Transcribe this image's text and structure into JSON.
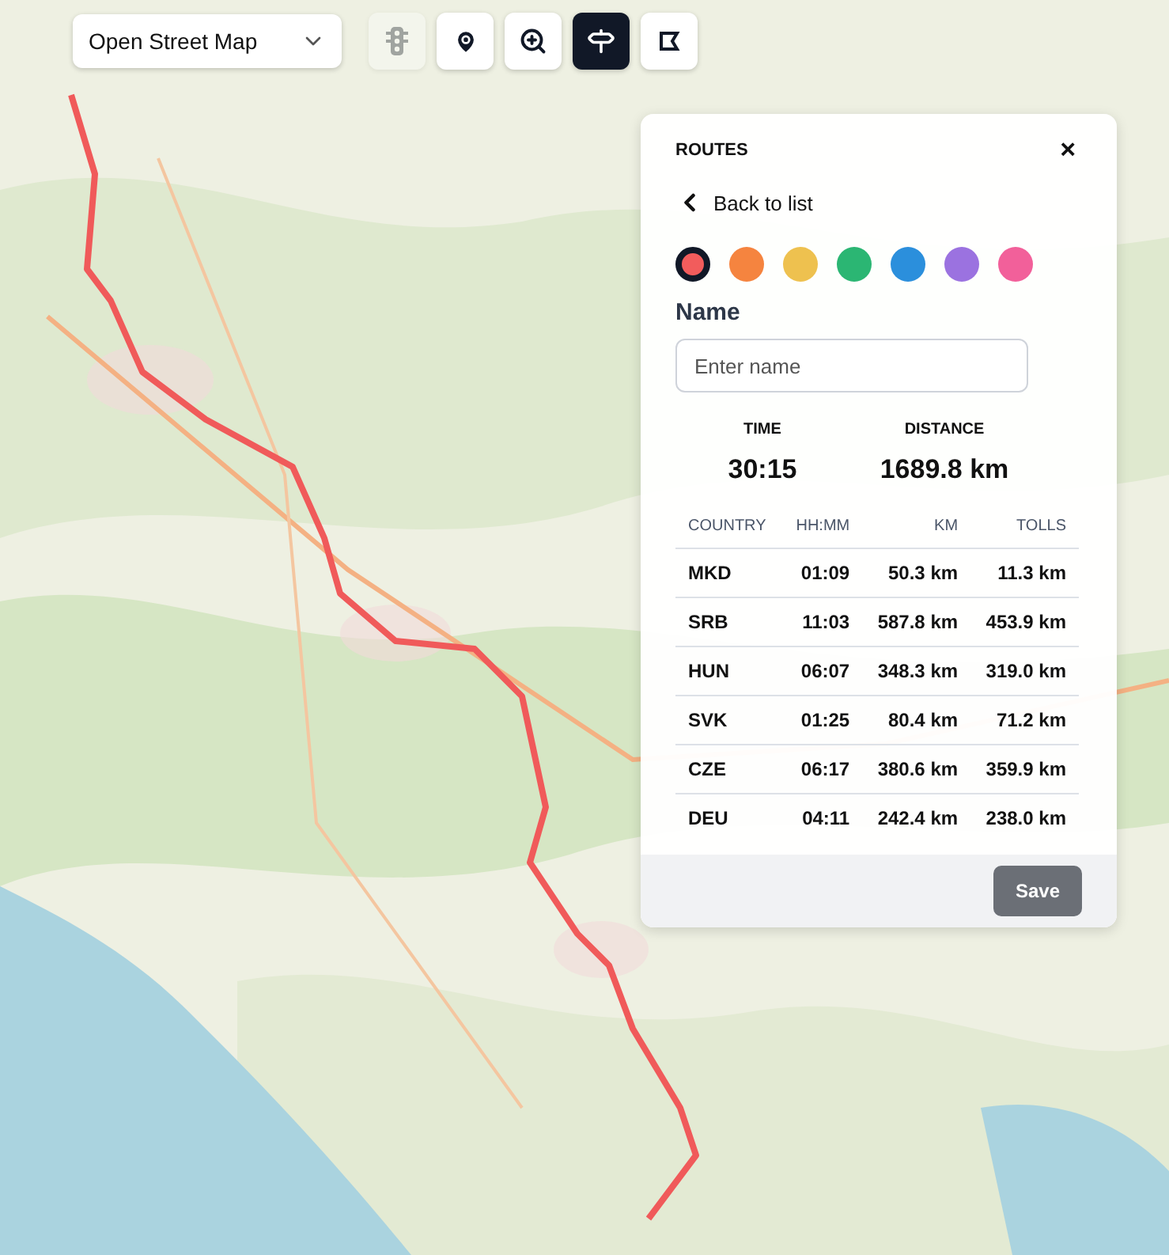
{
  "map_type_select": {
    "value": "Open Street Map"
  },
  "toolbar": [
    {
      "kind": "traffic",
      "selected": false,
      "disabled": true
    },
    {
      "kind": "pin",
      "selected": false,
      "disabled": false
    },
    {
      "kind": "zoom",
      "selected": false,
      "disabled": false
    },
    {
      "kind": "route",
      "selected": true,
      "disabled": false
    },
    {
      "kind": "area",
      "selected": false,
      "disabled": false
    }
  ],
  "routes_panel": {
    "title": "ROUTES",
    "close": "×",
    "back": "Back to list",
    "colors": [
      {
        "color": "#f25c5c",
        "selected": true
      },
      {
        "color": "#f5843f",
        "selected": false
      },
      {
        "color": "#eec14f",
        "selected": false
      },
      {
        "color": "#2bb673",
        "selected": false
      },
      {
        "color": "#2b8fdc",
        "selected": false
      },
      {
        "color": "#9b72e0",
        "selected": false
      },
      {
        "color": "#f2609a",
        "selected": false
      }
    ],
    "name_label": "Name",
    "name_field": {
      "placeholder": "Enter name"
    },
    "summary": [
      {
        "label": "TIME",
        "value": "30:15"
      },
      {
        "label": "DISTANCE",
        "value": "1689.8 km"
      }
    ],
    "table": {
      "columns": [
        "COUNTRY",
        "HH:MM",
        "KM",
        "TOLLS"
      ],
      "rows": [
        [
          "MKD",
          "01:09",
          "50.3 km",
          "11.3 km"
        ],
        [
          "SRB",
          "11:03",
          "587.8 km",
          "453.9 km"
        ],
        [
          "HUN",
          "06:07",
          "348.3 km",
          "319.0 km"
        ],
        [
          "SVK",
          "01:25",
          "80.4 km",
          "71.2 km"
        ],
        [
          "CZE",
          "06:17",
          "380.6 km",
          "359.9 km"
        ],
        [
          "DEU",
          "04:11",
          "242.4 km",
          "238.0 km"
        ]
      ]
    },
    "save": {
      "label": "Save",
      "disabled": true
    }
  }
}
